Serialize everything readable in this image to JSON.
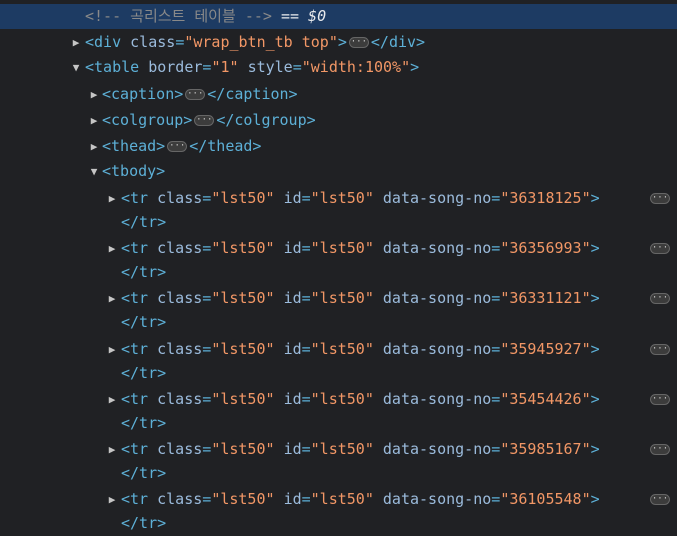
{
  "comment_row": {
    "text": "<!-- 곡리스트 테이블 -->",
    "eq": "==",
    "var": "$0"
  },
  "div_row": {
    "open": "<div",
    "attr": "class",
    "eq": "=",
    "value": "\"wrap_btn_tb top\"",
    "gt": ">",
    "close": "</div>"
  },
  "table_row": {
    "open": "<table",
    "attr1": "border",
    "val1": "\"1\"",
    "attr2": "style",
    "val2": "\"width:100%\"",
    "eq": "=",
    "gt": ">"
  },
  "caption_row": {
    "open": "<caption>",
    "close": "</caption>"
  },
  "colgroup_row": {
    "open": "<colgroup>",
    "close": "</colgroup>"
  },
  "thead_row": {
    "open": "<thead>",
    "close": "</thead>"
  },
  "tbody_row": {
    "open": "<tbody>"
  },
  "tr_common": {
    "open": "<tr",
    "class_attr": "class",
    "class_val": "\"lst50\"",
    "id_attr": "id",
    "id_val": "\"lst50\"",
    "song_attr": "data-song-no",
    "eq": "=",
    "gt": ">",
    "close": "</tr>"
  },
  "tr_rows": [
    {
      "song_no": "\"36318125\""
    },
    {
      "song_no": "\"36356993\""
    },
    {
      "song_no": "\"36331121\""
    },
    {
      "song_no": "\"35945927\""
    },
    {
      "song_no": "\"35454426\""
    },
    {
      "song_no": "\"35985167\""
    },
    {
      "song_no": "\"36105548\""
    }
  ],
  "ellipsis": "···",
  "icons": {
    "expanded": "triangle-down",
    "collapsed": "triangle-right"
  }
}
